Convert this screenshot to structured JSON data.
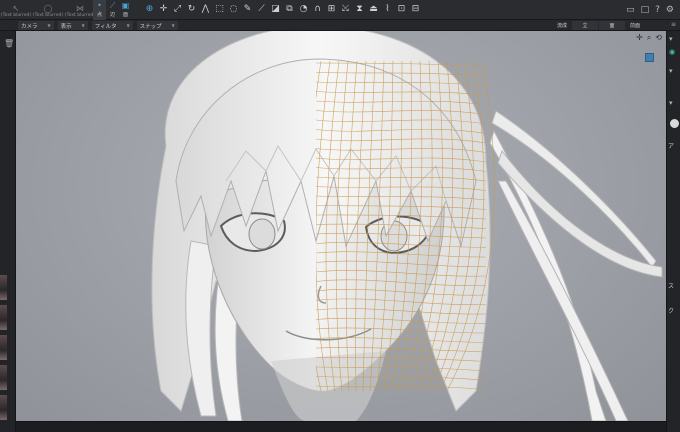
{
  "toolbar": {
    "modes": [
      {
        "name": "object-select",
        "icon": "cursor-icon",
        "glyph": "↖",
        "label": "(Text blurred)"
      },
      {
        "name": "group-select",
        "icon": "group-icon",
        "glyph": "◯",
        "label": "(Text blurred)"
      },
      {
        "name": "symmetry-edit",
        "icon": "butterfly-icon",
        "glyph": "⋈",
        "label": "(Text blurred)"
      }
    ],
    "selection_modes": [
      {
        "name": "vertex",
        "glyph": "•",
        "label": "点",
        "active": true
      },
      {
        "name": "edge",
        "glyph": "⟋",
        "label": "辺",
        "active": false
      },
      {
        "name": "face",
        "glyph": "▣",
        "label": "面",
        "active": false
      }
    ],
    "tools": [
      {
        "name": "world-icon",
        "glyph": "⊕",
        "active": true
      },
      {
        "name": "move-icon",
        "glyph": "✛"
      },
      {
        "name": "scale-arrow-icon",
        "glyph": "⤢"
      },
      {
        "name": "rotate-icon",
        "glyph": "↻"
      },
      {
        "name": "axis-icon",
        "glyph": "⋀"
      },
      {
        "name": "rect-select-icon",
        "glyph": "⬚"
      },
      {
        "name": "lasso-icon",
        "glyph": "◌"
      },
      {
        "name": "pen-icon",
        "glyph": "✎"
      },
      {
        "name": "knife-icon",
        "glyph": "⟋"
      },
      {
        "name": "fill-icon",
        "glyph": "◪"
      },
      {
        "name": "copy-icon",
        "glyph": "⧉"
      },
      {
        "name": "shape-icon",
        "glyph": "◔"
      },
      {
        "name": "arch-icon",
        "glyph": "∩"
      },
      {
        "name": "grid-cut-icon",
        "glyph": "⊞"
      },
      {
        "name": "merge-icon",
        "glyph": "⤩"
      },
      {
        "name": "bevel-icon",
        "glyph": "⧗"
      },
      {
        "name": "stamp-icon",
        "glyph": "⏏"
      },
      {
        "name": "brush-icon",
        "glyph": "⌇"
      },
      {
        "name": "render-icon",
        "glyph": "⊡"
      },
      {
        "name": "export-icon",
        "glyph": "⊟"
      }
    ],
    "right_icons": [
      {
        "name": "layout-icon",
        "glyph": "▭"
      },
      {
        "name": "window-icon",
        "glyph": "□"
      },
      {
        "name": "help-icon",
        "glyph": "?"
      },
      {
        "name": "settings-icon",
        "glyph": "⚙"
      }
    ]
  },
  "subbar": {
    "menus": [
      "カメラ",
      "表示",
      "フィルタ",
      "スナップ"
    ],
    "panel_tabs": [
      "流成",
      "立",
      "面",
      "前面"
    ],
    "right_glyph": "≡"
  },
  "viewport": {
    "nav_icons": [
      {
        "name": "pan-icon",
        "glyph": "✛"
      },
      {
        "name": "zoom-icon",
        "glyph": "⌕"
      },
      {
        "name": "orbit-icon",
        "glyph": "⟲"
      }
    ],
    "model": "anime character head, left half smooth shaded, right half wireframe mesh overlay",
    "wire_color": "#c89a4a",
    "bg_color": "#9fa3a9"
  },
  "left_panel": {
    "trash_glyph": "🗑"
  },
  "right_panel": {
    "labels": [
      "ア",
      "ス",
      "ク"
    ]
  },
  "colors": {
    "accent": "#4aa3d8",
    "teal": "#3fc1b0",
    "panel": "#2b2c30"
  }
}
